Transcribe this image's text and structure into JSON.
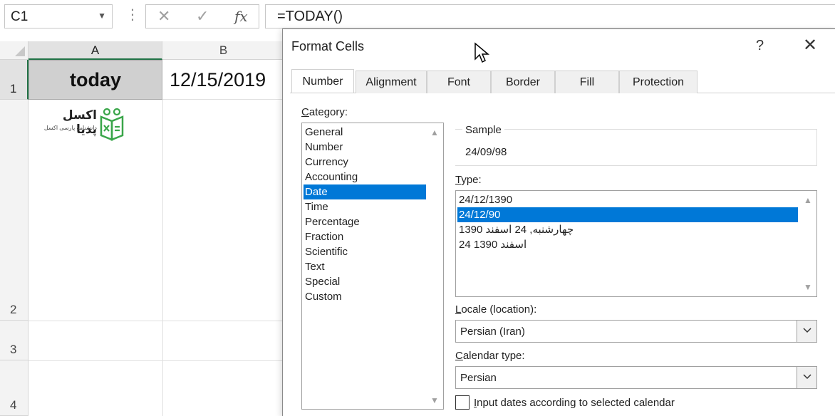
{
  "formula_bar": {
    "name_box": "C1",
    "formula": "=TODAY()",
    "fx_label": "fx"
  },
  "sheet": {
    "columns": [
      "A",
      "B"
    ],
    "rows": [
      "1",
      "2",
      "3",
      "4"
    ],
    "cell_a1": "today",
    "cell_b1": "12/15/2019",
    "logo": {
      "title": "اکسل پدیا",
      "subtitle": "دانشنامه پارسی اکسل"
    },
    "selected_column_color": "#217346"
  },
  "dialog": {
    "title": "Format Cells",
    "help_glyph": "?",
    "close_glyph": "✕",
    "tabs": [
      "Number",
      "Alignment",
      "Font",
      "Border",
      "Fill",
      "Protection"
    ],
    "active_tab": "Number",
    "category_label_first": "C",
    "category_label_rest": "ategory:",
    "categories": [
      "General",
      "Number",
      "Currency",
      "Accounting",
      "Date",
      "Time",
      "Percentage",
      "Fraction",
      "Scientific",
      "Text",
      "Special",
      "Custom"
    ],
    "selected_category": "Date",
    "sample_label": "Sample",
    "sample_value": "24/09/98",
    "type_label_first": "T",
    "type_label_rest": "ype:",
    "types": [
      "24/12/1390",
      "24/12/90",
      "چهارشنبه, 24 اسفند 1390",
      "24 اسفند 1390"
    ],
    "selected_type": "24/12/90",
    "locale_label_first": "L",
    "locale_label_rest": "ocale (location):",
    "locale_value": "Persian (Iran)",
    "calendar_label_first": "C",
    "calendar_label_rest": "alendar type:",
    "calendar_value": "Persian",
    "checkbox_label_first": "I",
    "checkbox_label_rest": "nput dates according to selected calendar",
    "checkbox_checked": false,
    "selection_color": "#0078d7"
  }
}
